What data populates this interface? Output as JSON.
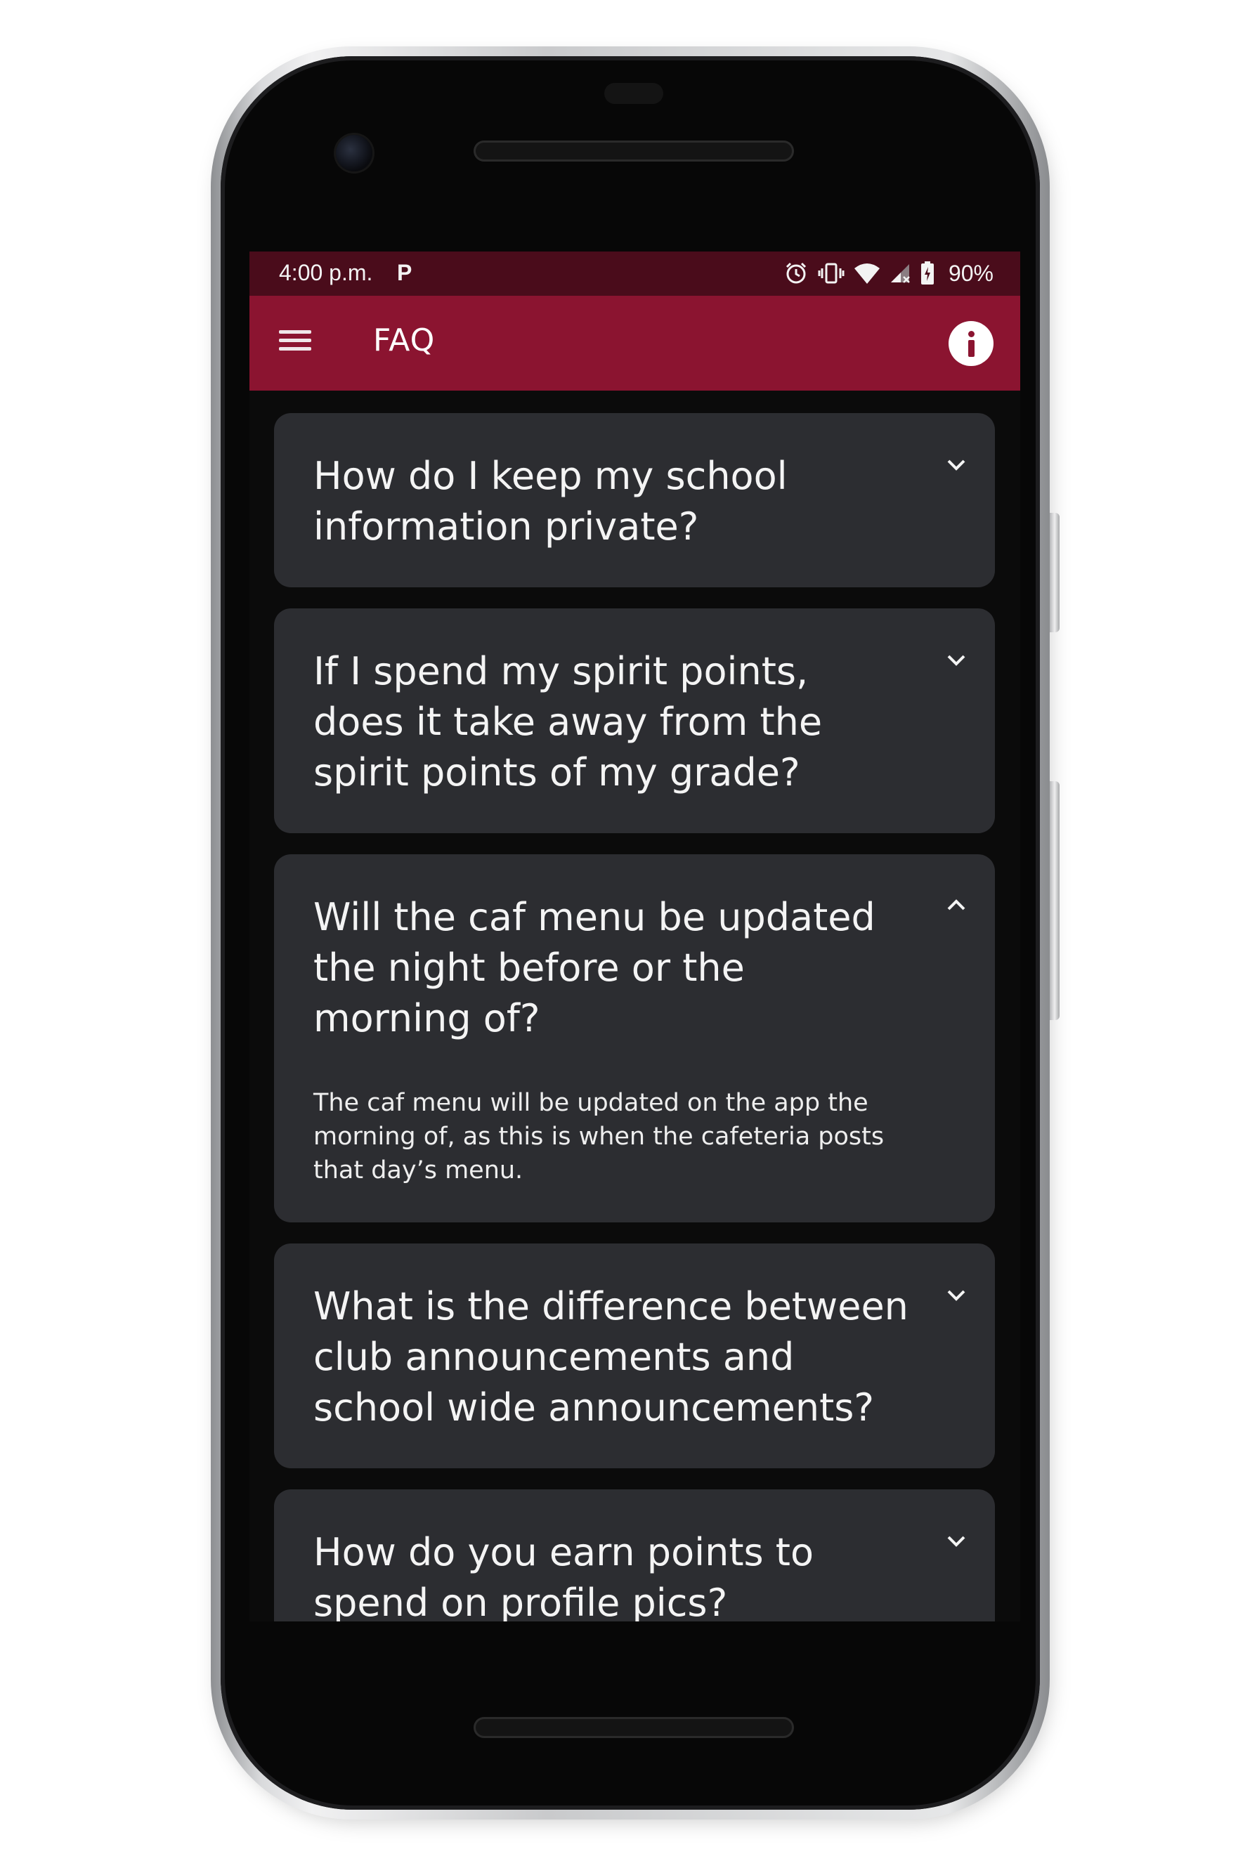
{
  "status_bar": {
    "time": "4:00 p.m.",
    "notification_glyph": "P",
    "battery": "90%",
    "icons": [
      "alarm-icon",
      "vibrate-icon",
      "wifi-icon",
      "signal-icon",
      "battery-icon"
    ]
  },
  "app_bar": {
    "title": "FAQ",
    "menu_icon": "hamburger-menu-icon",
    "info_icon": "info-icon"
  },
  "colors": {
    "status_bar": "#4a0c1b",
    "app_bar": "#8b1430",
    "background": "#0b0b0b",
    "card": "#2c2d31",
    "text": "#f4f4f4"
  },
  "faq": [
    {
      "question": "How do I keep my school information private?",
      "expanded": false,
      "chevron": "chevron-down-icon"
    },
    {
      "question": "If I spend my spirit points, does it take away from the spirit points of my grade?",
      "expanded": false,
      "chevron": "chevron-down-icon"
    },
    {
      "question": "Will the caf menu be updated the night before or the morning of?",
      "answer": "The caf menu will be updated on the app the morning of, as this is when the cafeteria posts that day’s menu.",
      "expanded": true,
      "chevron": "chevron-up-icon"
    },
    {
      "question": "What is the difference between club announcements and school wide announcements?",
      "expanded": false,
      "chevron": "chevron-down-icon"
    },
    {
      "question": "How do you earn points to spend on profile pics?",
      "expanded": false,
      "chevron": "chevron-down-icon"
    }
  ]
}
